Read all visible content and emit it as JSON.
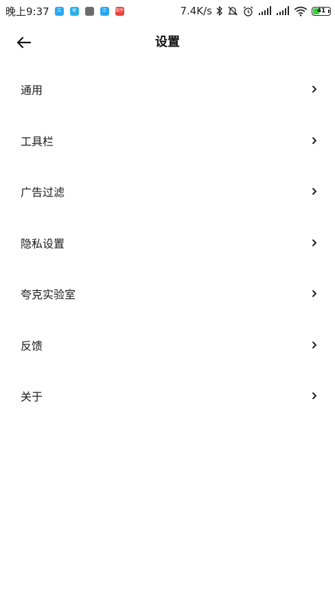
{
  "status_bar": {
    "time": "晚上9:37",
    "net_speed": "7.4K/s",
    "battery_level": "41",
    "battery_fraction": 0.41,
    "battery_color": "#3ecf3e",
    "apps": [
      {
        "icon": "app-icon-blue",
        "color": "#2aa7f0",
        "label": "江"
      },
      {
        "icon": "app-icon-cyan",
        "color": "#2ab0e8",
        "label": "㊙"
      },
      {
        "icon": "app-icon-gray",
        "color": "#6b6b6b",
        "label": ""
      },
      {
        "icon": "app-icon-blue",
        "color": "#2aa7f0",
        "label": "江"
      },
      {
        "icon": "app-icon-red",
        "color": "#e8453c",
        "label": "知乎"
      }
    ],
    "icons": [
      "bluetooth-icon",
      "mute-icon",
      "alarm-icon",
      "signal-icon",
      "signal-icon",
      "wifi-icon",
      "battery-icon"
    ]
  },
  "header": {
    "back_icon": "arrow-left-icon",
    "title": "设置"
  },
  "settings": {
    "items": [
      {
        "label": "通用"
      },
      {
        "label": "工具栏"
      },
      {
        "label": "广告过滤"
      },
      {
        "label": "隐私设置"
      },
      {
        "label": "夸克实验室"
      },
      {
        "label": "反馈"
      },
      {
        "label": "关于"
      }
    ],
    "chevron_icon": "chevron-right-icon"
  }
}
